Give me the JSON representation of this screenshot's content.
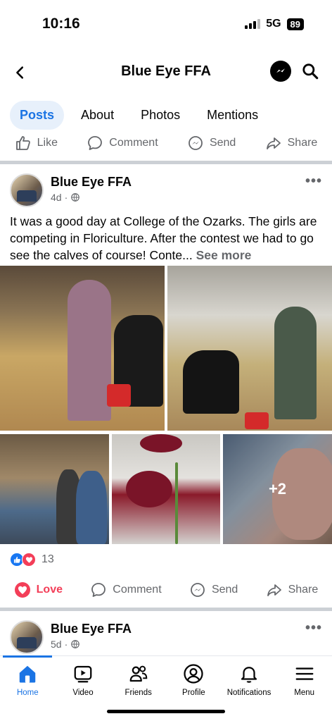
{
  "status_bar": {
    "time": "10:16",
    "network": "5G",
    "battery": "89"
  },
  "header": {
    "title": "Blue Eye FFA",
    "back_icon": "chevron-left-icon",
    "messenger_icon": "messenger-icon",
    "search_icon": "search-icon"
  },
  "tabs": [
    {
      "label": "Posts",
      "active": true
    },
    {
      "label": "About"
    },
    {
      "label": "Photos"
    },
    {
      "label": "Mentions"
    }
  ],
  "page_actions": {
    "like": "Like",
    "comment": "Comment",
    "send": "Send",
    "share": "Share"
  },
  "post": {
    "author": "Blue Eye FFA",
    "time": "4d",
    "visibility_icon": "globe-icon",
    "text": "It was a good day at College of the Ozarks. The girls are competing in Floriculture. After the contest we had to go see the calves of course! Conte...",
    "see_more": "See more",
    "extra_photos": "+2",
    "reaction_count": "13",
    "actions": {
      "love": "Love",
      "comment": "Comment",
      "send": "Send",
      "share": "Share"
    }
  },
  "next_post": {
    "author": "Blue Eye FFA",
    "time": "5d"
  },
  "bottom_nav": {
    "home": "Home",
    "video": "Video",
    "friends": "Friends",
    "profile": "Profile",
    "notifications": "Notifications",
    "menu": "Menu"
  },
  "colors": {
    "accent": "#1b74e4",
    "love": "#f33e58",
    "muted": "#65676b"
  }
}
